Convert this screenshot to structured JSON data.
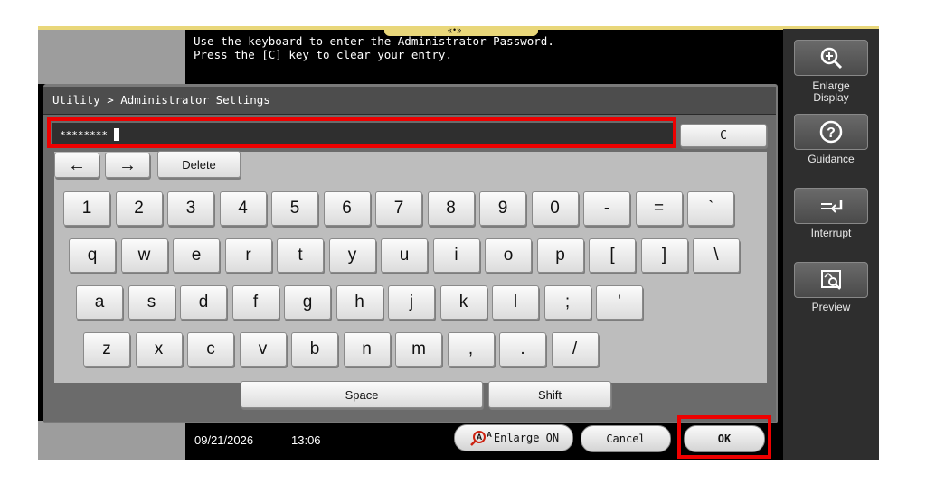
{
  "message": {
    "line1": "Use the keyboard to enter the Administrator Password.",
    "line2": "Press the [C] key to clear your entry."
  },
  "breadcrumb": "Utility > Administrator Settings",
  "password": {
    "value": "********"
  },
  "clear_label": "C",
  "nav": {
    "left": "←",
    "right": "→",
    "delete": "Delete"
  },
  "keys": {
    "row1": [
      "1",
      "2",
      "3",
      "4",
      "5",
      "6",
      "7",
      "8",
      "9",
      "0",
      "-",
      "=",
      "`"
    ],
    "row2": [
      "q",
      "w",
      "e",
      "r",
      "t",
      "y",
      "u",
      "i",
      "o",
      "p",
      "[",
      "]",
      "\\"
    ],
    "row3": [
      "a",
      "s",
      "d",
      "f",
      "g",
      "h",
      "j",
      "k",
      "l",
      ";",
      "'"
    ],
    "row4": [
      "z",
      "x",
      "c",
      "v",
      "b",
      "n",
      "m",
      ",",
      ".",
      "/"
    ]
  },
  "space_label": "Space",
  "shift_label": "Shift",
  "side": {
    "enlarge_label": "Enlarge\nDisplay",
    "guidance_label": "Guidance",
    "interrupt_label": "Interrupt",
    "preview_label": "Preview"
  },
  "status": {
    "date": "09/21/2026",
    "time": "13:06"
  },
  "footer": {
    "enlarge_on": "Enlarge ON",
    "cancel": "Cancel",
    "ok": "OK"
  },
  "icons": {
    "enlarge": "magnifier-plus-icon",
    "guidance": "question-icon",
    "interrupt": "interrupt-icon",
    "preview": "preview-icon",
    "enlarge_on": "magnifier-a-icon"
  },
  "colors": {
    "highlight": "#e00000",
    "panel": "#2e2e2e",
    "keyboard_bg": "#bdbdbd"
  }
}
